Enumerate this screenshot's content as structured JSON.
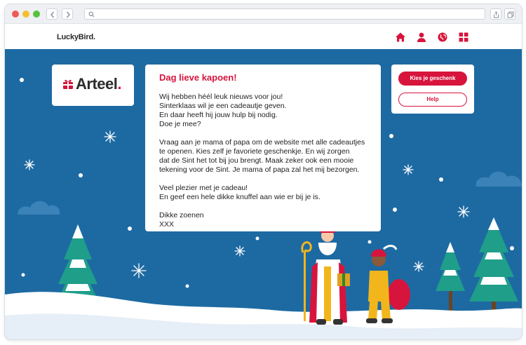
{
  "header": {
    "brand": "LuckyBird."
  },
  "logo": {
    "name": "Arteel",
    "dot": "."
  },
  "letter": {
    "title": "Dag lieve kapoen!",
    "paragraphs": [
      [
        "Wij hebben héél leuk nieuws voor jou!",
        "Sinterklaas wil je een cadeautje geven.",
        "En daar heeft hij jouw hulp bij nodig.",
        "Doe je mee?"
      ],
      [
        "Vraag aan je mama of papa om de website met alle cadeautjes",
        "te openen. Kies zelf je favoriete geschenkje. En wij zorgen",
        "dat de Sint het tot bij jou brengt. Maak zeker ook een mooie",
        "tekening voor de Sint. Je mama of papa zal het mij bezorgen."
      ],
      [
        "Veel plezier met je cadeau!",
        "En geef een hele dikke knuffel aan wie er bij je is."
      ],
      [
        "Dikke zoenen",
        "XXX"
      ]
    ]
  },
  "actions": {
    "primary_label": "Kies je geschenk",
    "secondary_label": "Help"
  },
  "colors": {
    "accent": "#d7143c",
    "sky": "#1d6aa3",
    "snow": "#ffffff"
  },
  "icons": [
    "home-icon",
    "user-icon",
    "globe-icon",
    "grid-icon",
    "search-icon",
    "share-icon",
    "tabs-icon",
    "gift-icon"
  ]
}
